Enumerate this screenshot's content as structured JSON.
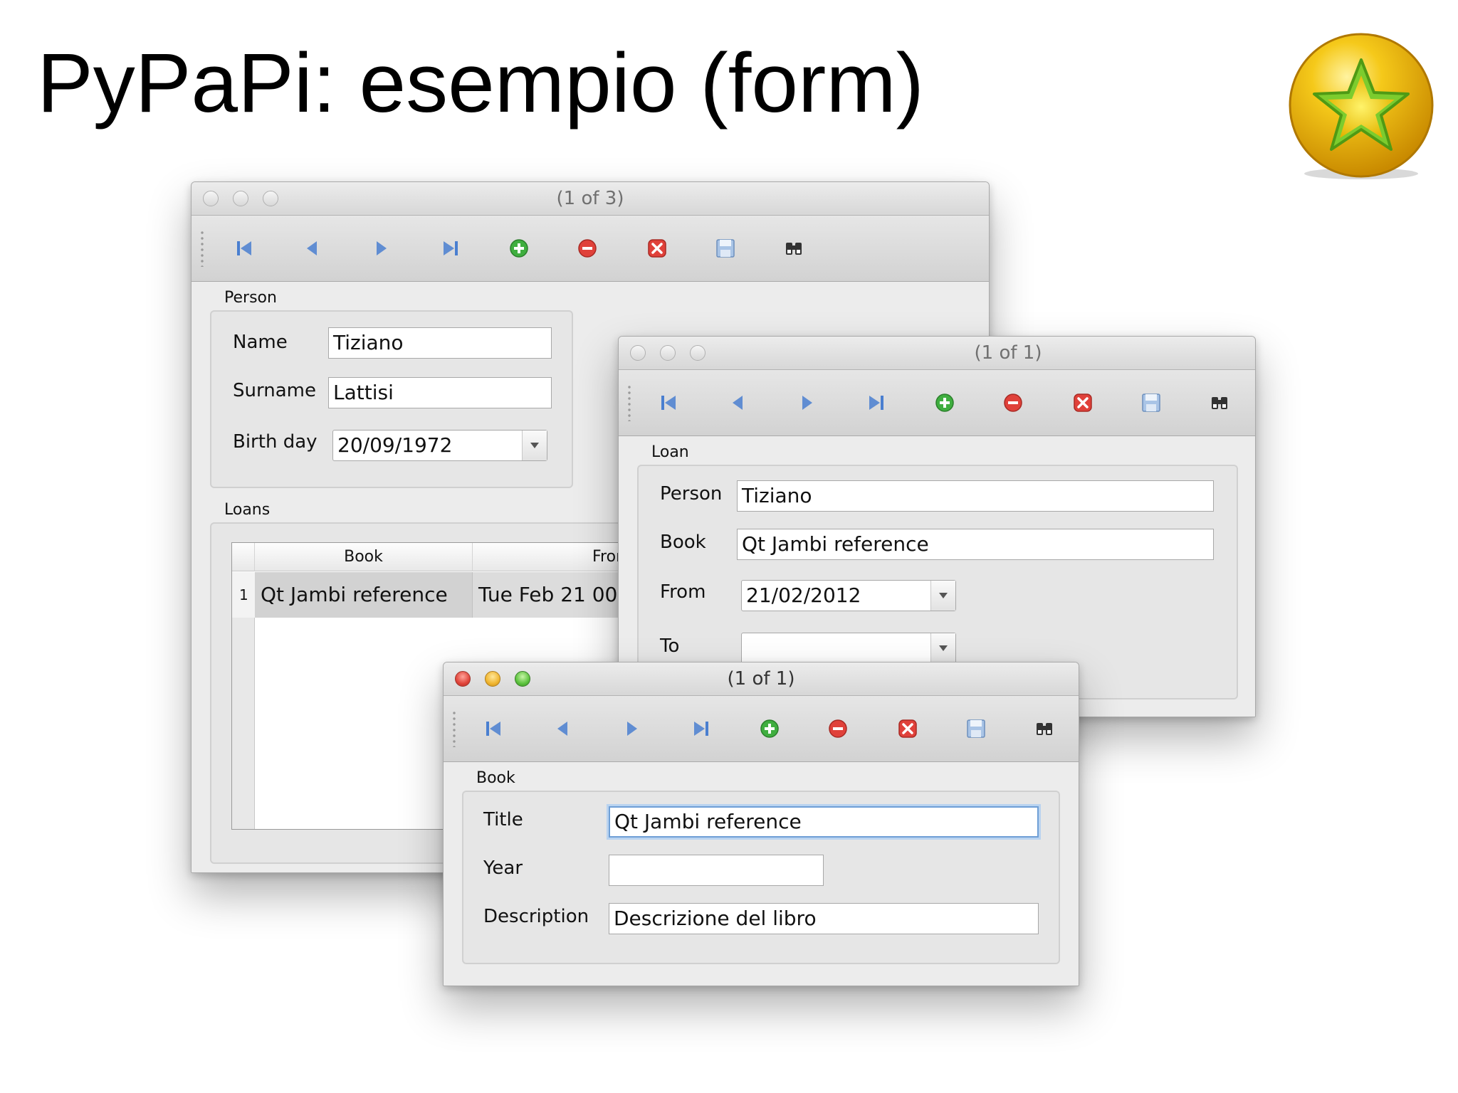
{
  "slide": {
    "title": "PyPaPi: esempio (form)",
    "logo_icon": "star-badge-icon"
  },
  "toolbar_icons": [
    "first-record-icon",
    "previous-record-icon",
    "next-record-icon",
    "last-record-icon",
    "add-record-icon",
    "remove-record-icon",
    "cancel-icon",
    "save-icon",
    "search-binoculars-icon"
  ],
  "person_window": {
    "title": "(1 of 3)",
    "group_person": "Person",
    "name_label": "Name",
    "name_value": "Tiziano",
    "surname_label": "Surname",
    "surname_value": "Lattisi",
    "birthday_label": "Birth day",
    "birthday_value": "20/09/1972",
    "group_loans": "Loans",
    "loans_table": {
      "columns": [
        "Book",
        "Fromd"
      ],
      "rows": [
        {
          "index": "1",
          "book": "Qt Jambi reference",
          "from": "Tue Feb 21 00:00"
        }
      ]
    }
  },
  "loan_window": {
    "title": "(1 of 1)",
    "group": "Loan",
    "person_label": "Person",
    "person_value": "Tiziano",
    "book_label": "Book",
    "book_value": "Qt Jambi reference",
    "from_label": "From",
    "from_value": "21/02/2012",
    "to_label": "To",
    "to_value": ""
  },
  "book_window": {
    "title": "(1 of 1)",
    "group": "Book",
    "title_label": "Title",
    "title_value": "Qt Jambi reference",
    "year_label": "Year",
    "year_value": "",
    "description_label": "Description",
    "description_value": "Descrizione del libro"
  },
  "colors": {
    "focus_ring": "#6f9fd6",
    "nav_blue": "#4a7fd0",
    "add_green": "#3fae3f",
    "remove_red": "#e0413a"
  }
}
